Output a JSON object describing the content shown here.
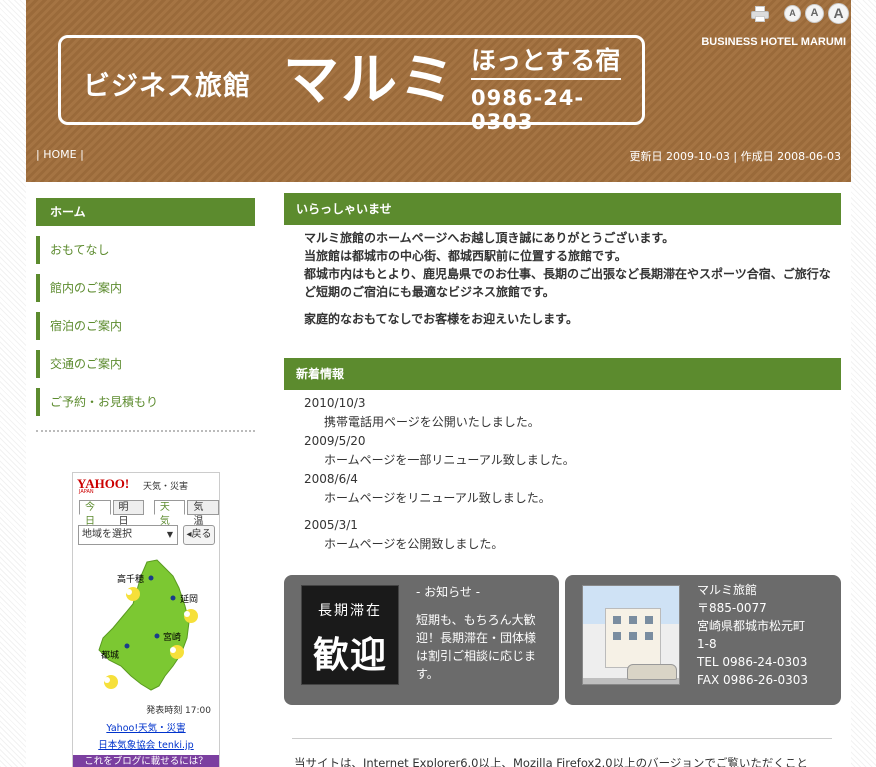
{
  "header": {
    "logo_small": "ビジネス旅館",
    "logo_big": "マルミ",
    "logo_tag": "ほっとする宿",
    "logo_phone": "0986-24-0303",
    "brand_en": "BUSINESS HOTEL MARUMI",
    "font_sizes": [
      "A",
      "A",
      "A"
    ],
    "home_link": "HOME",
    "dates": "更新日 2009-10-03 | 作成日 2008-06-03",
    "colors": {
      "header_brown": "#9a6a3a",
      "accent_green": "#5c8b2e"
    }
  },
  "sidebar": {
    "active": "ホーム",
    "items": [
      "おもてなし",
      "館内のご案内",
      "宿泊のご案内",
      "交通のご案内",
      "ご予約・お見積もり"
    ]
  },
  "weather": {
    "logo": "YAHOO!",
    "logo_sub": "JAPAN",
    "title": "天気・災害",
    "tabs": [
      "今日",
      "明日",
      "天気",
      "気温"
    ],
    "select_placeholder": "地域を選択",
    "back_label": "戻る",
    "cities": [
      "高千穂",
      "延岡",
      "宮崎",
      "都城"
    ],
    "update_time": "発表時刻 17:00",
    "link1": "Yahoo!天気・災害",
    "link2": "日本気象協会 tenki.jp",
    "link3": "これをブログに載せるには？"
  },
  "welcome": {
    "heading": "いらっしゃいませ",
    "lines": [
      "マルミ旅館のホームページへお越し頂き誠にありがとうございます。",
      "当旅館は都城市の中心街、都城西駅前に位置する旅館です。",
      "都城市内はもとより、鹿児島県でのお仕事、長期のご出張など長期滞在やスポーツ合宿、ご旅行など短期のご宿泊にも最適なビジネス旅館です。"
    ],
    "closing": "家庭的なおもてなしでお客様をお迎えいたします。"
  },
  "news": {
    "heading": "新着情報",
    "items": [
      {
        "date": "2010/10/3",
        "text": "携帯電話用ページを公開いたしました。"
      },
      {
        "date": "2009/5/20",
        "text": "ホームページを一部リニューアル致しました。"
      },
      {
        "date": "2008/6/4",
        "text": "ホームページをリニューアル致しました。"
      },
      {
        "date": "2005/3/1",
        "text": "ホームページを公開致しました。"
      }
    ]
  },
  "notice": {
    "img_line1": "長期滞在",
    "img_line2": "歓迎",
    "title": "- お知らせ -",
    "body": "短期も、もちろん大歓迎！長期滞在・団体様は割引ご相談に応じます。"
  },
  "hotel": {
    "name": "マルミ旅館",
    "postal": "〒885-0077",
    "address1": "宮崎県都城市松元町",
    "address2": "1-8",
    "tel": "TEL 0986-24-0303",
    "fax": "FAX 0986-26-0303"
  },
  "footer": {
    "text": "当サイトは、Internet Explorer6.0以上、Mozilla Firefox2.0以上のバージョンでご覧いただくこと"
  }
}
